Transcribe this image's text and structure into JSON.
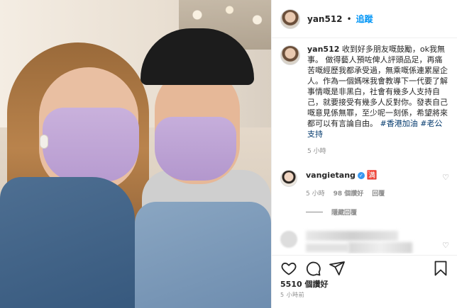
{
  "post": {
    "username": "yan512",
    "follow_label": "追蹤",
    "caption": "收到好多朋友嘅鼓勵，ok我無事。 做得藝人預咗俾人評頭品足，再痛苦嘅經歷我都承受過，無乘嘅係連累屋企人。作為一個媽咪我會教導下一代要了解事情嘅是非黑白，社會有幾多人支持自己，就要接受有幾多人反對你。發表自己嘅意見係無罪，至少呢一刻係，希望將來都可以有言論自由。",
    "hashtags": [
      "#香港加油",
      "#老公支持"
    ],
    "time_ago": "5 小時",
    "likes": "5510 個讚好",
    "footer_time": "5 小時前"
  },
  "comment": {
    "username": "vangietang",
    "emoji": "🈵",
    "time_ago": "5 小時",
    "likes": "98 個讚好",
    "reply_label": "回覆",
    "view_replies": "隱藏回覆"
  },
  "colors": {
    "accent": "#0095f6",
    "text": "#262626",
    "muted": "#8e8e8e",
    "hashtag": "#00376b"
  },
  "icons": {
    "like": "heart-icon",
    "comment": "comment-icon",
    "share": "paper-plane-icon",
    "save": "bookmark-icon"
  }
}
